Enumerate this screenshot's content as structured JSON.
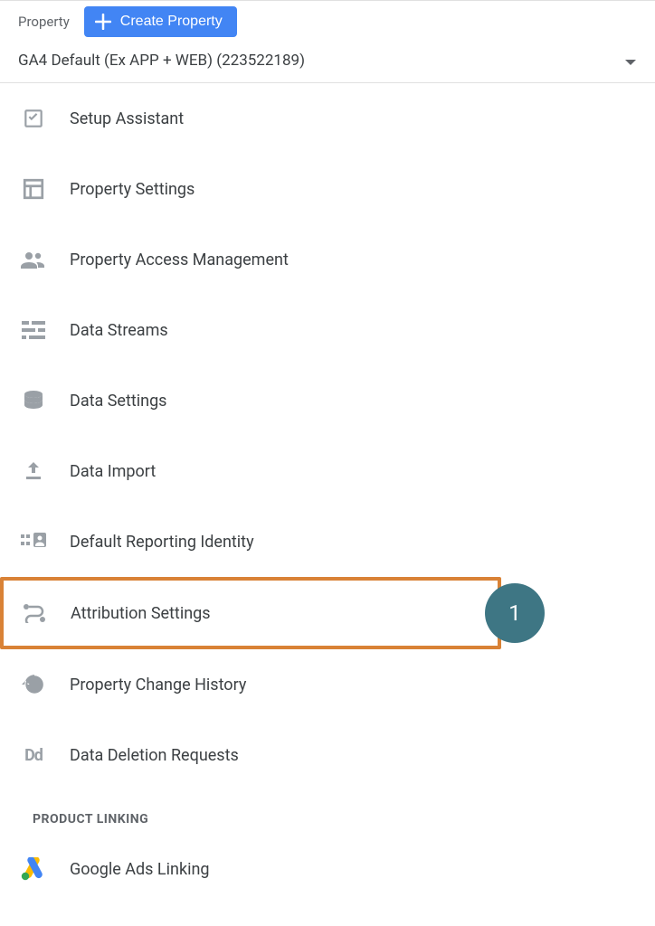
{
  "header": {
    "label": "Property",
    "create_button": "Create Property"
  },
  "property_selector": "GA4 Default (Ex APP + WEB) (223522189)",
  "menu": {
    "setup_assistant": "Setup Assistant",
    "property_settings": "Property Settings",
    "property_access": "Property Access Management",
    "data_streams": "Data Streams",
    "data_settings": "Data Settings",
    "data_import": "Data Import",
    "reporting_identity": "Default Reporting Identity",
    "attribution_settings": "Attribution Settings",
    "change_history": "Property Change History",
    "data_deletion": "Data Deletion Requests"
  },
  "annotation": {
    "badge": "1"
  },
  "section": {
    "product_linking": "PRODUCT LINKING",
    "google_ads_linking": "Google Ads Linking"
  }
}
